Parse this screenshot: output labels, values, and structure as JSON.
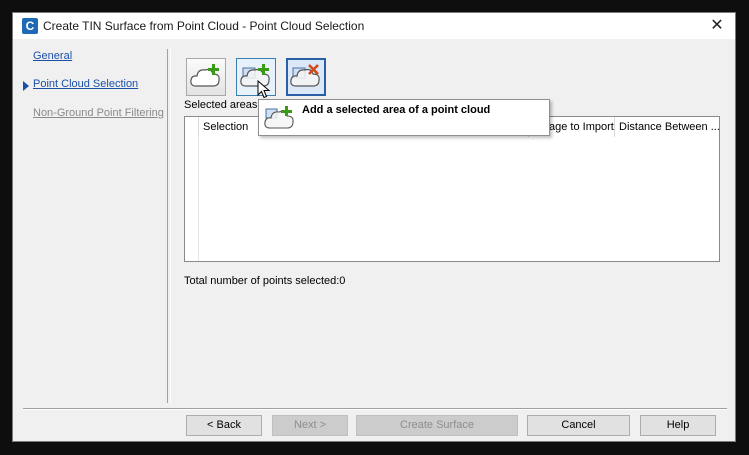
{
  "window": {
    "title": "Create TIN Surface from Point Cloud - Point Cloud Selection",
    "app_icon": "C",
    "close_icon": "✕"
  },
  "nav": {
    "items": [
      {
        "label": "General",
        "state": "link"
      },
      {
        "label": "Point Cloud Selection",
        "state": "current"
      },
      {
        "label": "Non-Ground Point Filtering",
        "state": "disabled"
      }
    ]
  },
  "toolbar": {
    "buttons": [
      {
        "icon": "add-point-cloud-icon",
        "state": "normal"
      },
      {
        "icon": "add-selected-area-icon",
        "state": "hover"
      },
      {
        "icon": "remove-point-cloud-icon",
        "state": "pressed"
      }
    ]
  },
  "tooltip": {
    "text": "Add a selected area of a point cloud",
    "icon": "add-selected-area-icon"
  },
  "selected_areas": {
    "label": "Selected areas:",
    "columns": [
      "Selection",
      "age to Import",
      "Distance Between ..."
    ],
    "rows": []
  },
  "total_points_label": "Total number of points selected:0",
  "footer": {
    "back": "< Back",
    "next": "Next >",
    "create": "Create Surface",
    "cancel": "Cancel",
    "help": "Help"
  },
  "colors": {
    "link": "#1b4fa8",
    "add_plus": "#3a9a1a",
    "remove_x": "#d04a1a",
    "selection_border": "#2a5fa8"
  }
}
